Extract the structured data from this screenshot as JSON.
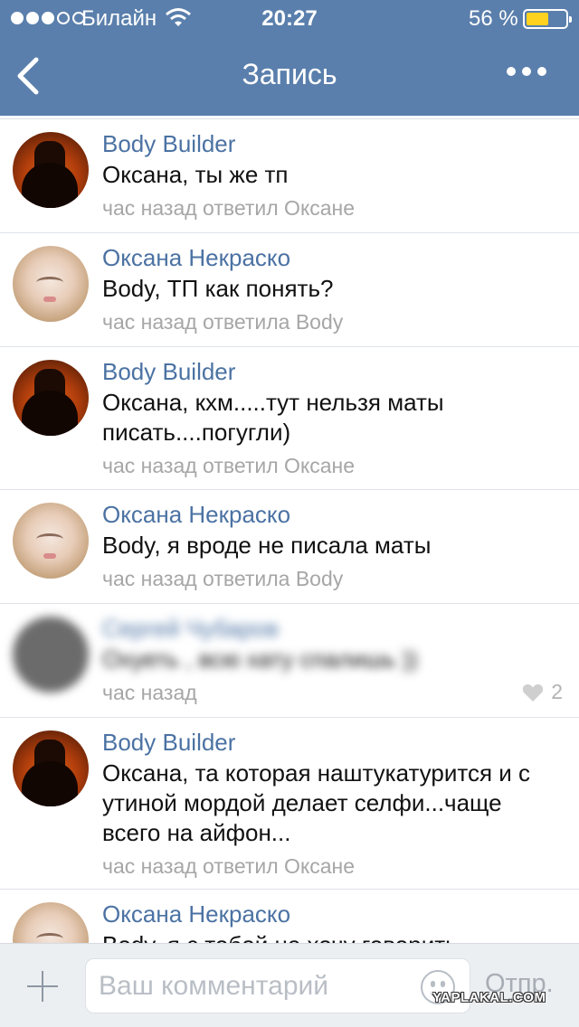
{
  "status_bar": {
    "carrier": "Билайн",
    "time": "20:27",
    "battery_percent": "56 %",
    "battery_level": 0.56,
    "signal_bars_filled": 3,
    "signal_bars_total": 5,
    "battery_color": "#ffd21f"
  },
  "nav": {
    "title": "Запись",
    "back_icon": "chevron-left-icon",
    "more_icon": "more-dots-icon"
  },
  "colors": {
    "header": "#5a7fac",
    "author_name": "#4b72a3",
    "meta": "#a6a6a6"
  },
  "comments": [
    {
      "author": "Body Builder",
      "text": "Оксана, ты же тп",
      "meta": "час назад ответил Оксане",
      "avatar": "batman"
    },
    {
      "author": "Оксана Некраско",
      "text": "Body, ТП как понять?",
      "meta": "час назад ответила Body",
      "avatar": "oksana"
    },
    {
      "author": "Body Builder",
      "text": "Оксана, кхм.....тут нельзя маты писать....погугли)",
      "meta": "час назад ответил Оксане",
      "avatar": "batman"
    },
    {
      "author": "Оксана Некраско",
      "text": "Body, я вроде не писала маты",
      "meta": "час назад ответила Body",
      "avatar": "oksana"
    },
    {
      "author": "Сергей Чубаров",
      "text": "Охуеть , всю хату спалишь ))",
      "meta": "час назад",
      "avatar": "blurred",
      "likes": "2"
    },
    {
      "author": "Body Builder",
      "text": "Оксана, та которая наштукатурится и с утиной мордой делает селфи...чаще всего на айфон...",
      "meta": "час назад ответил Оксане",
      "avatar": "batman"
    },
    {
      "author": "Оксана Некраско",
      "text": "Body, я с тобой не хочу говорить",
      "meta": "",
      "avatar": "oksana"
    }
  ],
  "composer": {
    "placeholder": "Ваш комментарий",
    "send_label": "Отпр.",
    "attach_icon": "plus-icon",
    "emoji_icon": "smile-icon"
  },
  "watermark": "YAPLAKAL.COM"
}
